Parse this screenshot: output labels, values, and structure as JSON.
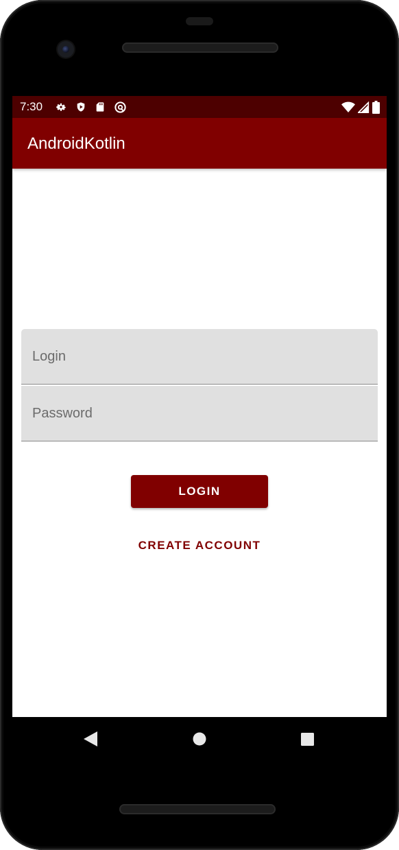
{
  "status_bar": {
    "time": "7:30",
    "left_icons": [
      "settings-icon",
      "shield-icon",
      "sd-card-icon",
      "at-sign-icon"
    ],
    "right_icons": [
      "wifi-icon",
      "signal-icon",
      "battery-icon"
    ]
  },
  "app_bar": {
    "title": "AndroidKotlin"
  },
  "form": {
    "login_placeholder": "Login",
    "login_value": "",
    "password_placeholder": "Password",
    "password_value": "",
    "login_button_label": "LOGIN",
    "create_account_label": "CREATE ACCOUNT"
  },
  "nav_bar": {
    "icons": [
      "back-icon",
      "home-icon",
      "recents-icon"
    ]
  },
  "colors": {
    "primary": "#800000",
    "primary_dark": "#4d0000",
    "field_background": "#e0e0e0"
  }
}
